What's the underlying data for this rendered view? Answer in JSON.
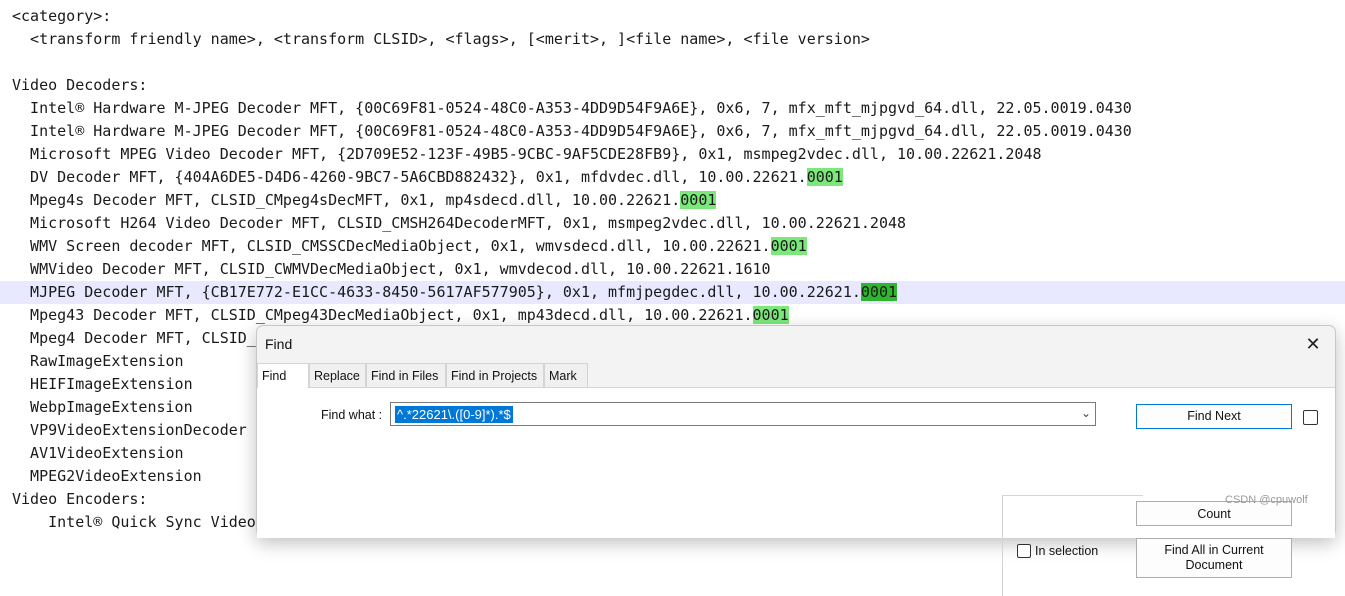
{
  "editor": {
    "lines": [
      {
        "text": "<category>:"
      },
      {
        "text": "  <transform friendly name>, <transform CLSID>, <flags>, [<merit>, ]<file name>, <file version>"
      },
      {
        "text": ""
      },
      {
        "text": "Video Decoders:"
      },
      {
        "text": "  Intel® Hardware M-JPEG Decoder MFT, {00C69F81-0524-48C0-A353-4DD9D54F9A6E}, 0x6, 7, mfx_mft_mjpgvd_64.dll, 22.05.0019.0430"
      },
      {
        "text": "  Intel® Hardware M-JPEG Decoder MFT, {00C69F81-0524-48C0-A353-4DD9D54F9A6E}, 0x6, 7, mfx_mft_mjpgvd_64.dll, 22.05.0019.0430"
      },
      {
        "text": "  Microsoft MPEG Video Decoder MFT, {2D709E52-123F-49B5-9CBC-9AF5CDE28FB9}, 0x1, msmpeg2vdec.dll, 10.00.22621.2048"
      },
      {
        "text": "  DV Decoder MFT, {404A6DE5-D4D6-4260-9BC7-5A6CBD882432}, 0x1, mfdvdec.dll, 10.00.22621.",
        "match": "0001"
      },
      {
        "text": "  Mpeg4s Decoder MFT, CLSID_CMpeg4sDecMFT, 0x1, mp4sdecd.dll, 10.00.22621.",
        "match": "0001"
      },
      {
        "text": "  Microsoft H264 Video Decoder MFT, CLSID_CMSH264DecoderMFT, 0x1, msmpeg2vdec.dll, 10.00.22621.2048"
      },
      {
        "text": "  WMV Screen decoder MFT, CLSID_CMSSCDecMediaObject, 0x1, wmvsdecd.dll, 10.00.22621.",
        "match": "0001"
      },
      {
        "text": "  WMVideo Decoder MFT, CLSID_CWMVDecMediaObject, 0x1, wmvdecod.dll, 10.00.22621.1610"
      },
      {
        "text": "  MJPEG Decoder MFT, {CB17E772-E1CC-4633-8450-5617AF577905}, 0x1, mfmjpegdec.dll, 10.00.22621.",
        "match": "0001",
        "current": true
      },
      {
        "text": "  Mpeg43 Decoder MFT, CLSID_CMpeg43DecMediaObject, 0x1, mp43decd.dll, 10.00.22621.",
        "match": "0001"
      },
      {
        "text": "  Mpeg4 Decoder MFT, CLSID_"
      },
      {
        "text": "  RawImageExtension"
      },
      {
        "text": "  HEIFImageExtension"
      },
      {
        "text": "  WebpImageExtension"
      },
      {
        "text": "  VP9VideoExtensionDecoder"
      },
      {
        "text": "  AV1VideoExtension"
      },
      {
        "text": "  MPEG2VideoExtension"
      },
      {
        "text": "Video Encoders:"
      },
      {
        "text": "    Intel® Quick Sync Video H"
      }
    ]
  },
  "find_dialog": {
    "title": "Find",
    "close_icon": "close-icon",
    "tabs": [
      "Find",
      "Replace",
      "Find in Files",
      "Find in Projects",
      "Mark"
    ],
    "active_tab": "Find",
    "find_what_label": "Find what :",
    "find_what_value": "^.*22621\\.([0-9]*).*$",
    "dropdown_icon": "chevron-down-icon",
    "find_next_label": "Find Next",
    "count_label": "Count",
    "find_all_current_label": "Find All in Current Document",
    "in_selection_label": "In selection",
    "accent_color": "#0078d7"
  },
  "watermark": "CSDN @cpuwolf",
  "colors": {
    "match_highlight": "#7ce87c",
    "current_line": "#e8e8ff",
    "selection": "#0078d7"
  }
}
